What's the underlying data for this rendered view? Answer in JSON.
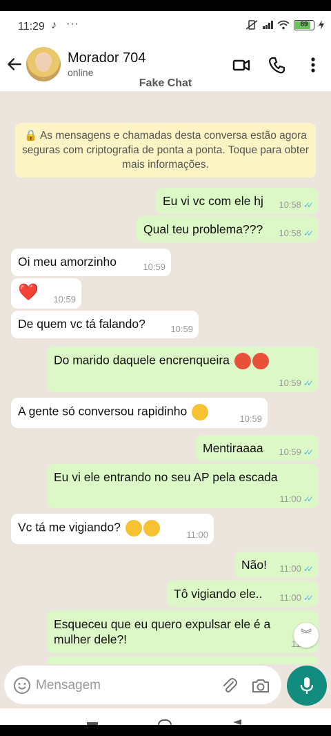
{
  "status_bar": {
    "time": "11:29",
    "extra_icon": "♪",
    "overflow": "···",
    "battery_level": "89"
  },
  "header": {
    "contact_name": "Morador 704",
    "contact_status": "online",
    "watermark": "Fake Chat"
  },
  "notice": "🔒 As mensagens e chamadas desta conversa estão agora seguras com criptografia de ponta a ponta. Toque para obter mais informações.",
  "messages": [
    {
      "text": "Eu vi vc com ele hj",
      "time": "10:58"
    },
    {
      "text": "Qual teu problema???",
      "time": "10:58"
    },
    {
      "text": "Oi meu amorzinho",
      "time": "10:59"
    },
    {
      "text": "❤️",
      "time": "10:59"
    },
    {
      "text": "De quem vc tá falando?",
      "time": "10:59"
    },
    {
      "text": "Do marido daquele encrenqueira",
      "time": "10:59"
    },
    {
      "text": "A gente só conversou rapidinho",
      "time": "10:59"
    },
    {
      "text": "Mentiraaaa",
      "time": "10:59"
    },
    {
      "text": "Eu vi ele entrando no seu AP pela escada",
      "time": "11:00"
    },
    {
      "text": "Vc tá me vigiando?",
      "time": "11:00"
    },
    {
      "text": "Não!",
      "time": "11:00"
    },
    {
      "text": "Tô vigiando ele..",
      "time": "11:00"
    },
    {
      "text": "Esqueceu que eu quero expulsar ele é a mulher dele?!",
      "time": "11:00"
    }
  ],
  "composer": {
    "placeholder": "Mensagem"
  },
  "colors": {
    "outgoing_bubble": "#dcf8c6",
    "incoming_bubble": "#ffffff",
    "read_tick": "#4fb6ec",
    "accent": "#128c7e",
    "chat_background": "#ece5dd"
  }
}
